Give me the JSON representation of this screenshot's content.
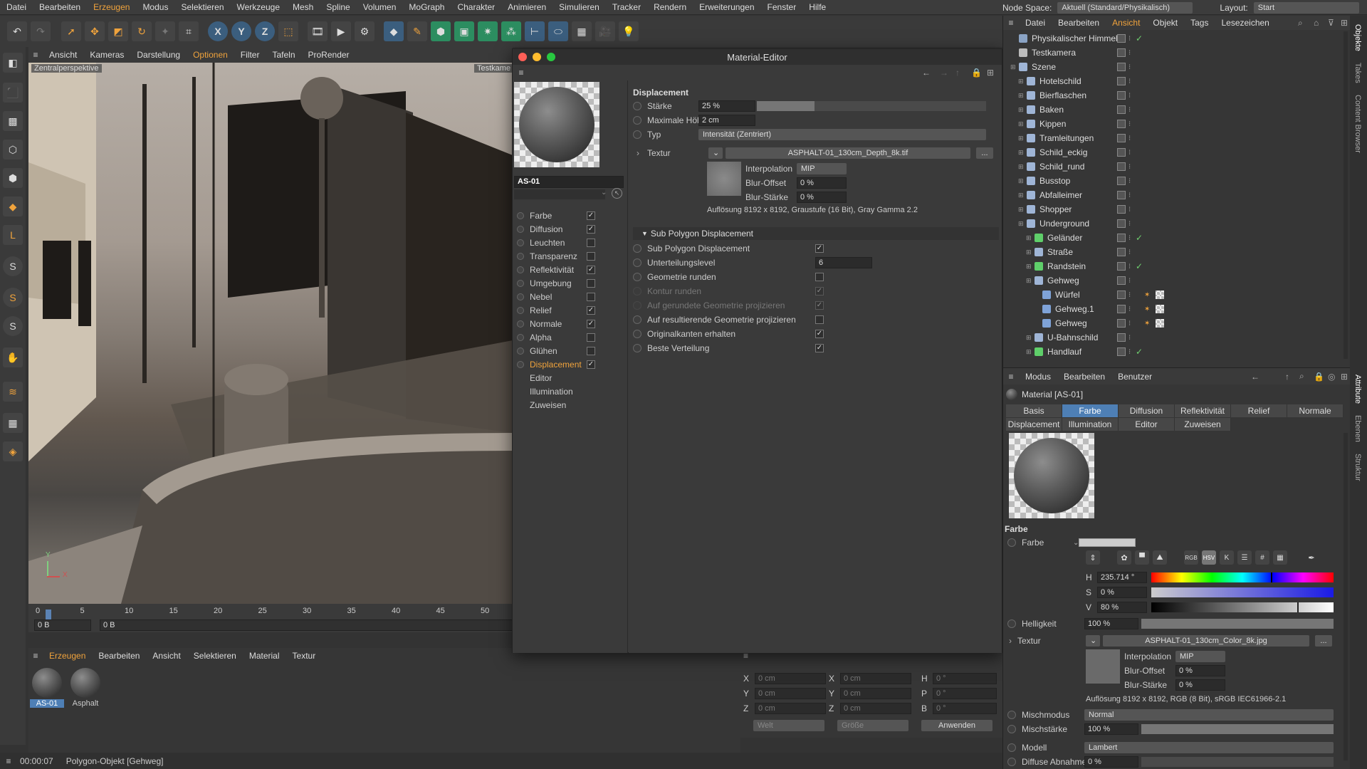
{
  "menubar": {
    "items": [
      "Datei",
      "Bearbeiten",
      "Erzeugen",
      "Modus",
      "Selektieren",
      "Werkzeuge",
      "Mesh",
      "Spline",
      "Volumen",
      "MoGraph",
      "Charakter",
      "Animieren",
      "Simulieren",
      "Tracker",
      "Rendern",
      "Erweiterungen",
      "Fenster",
      "Hilfe"
    ],
    "node_space_label": "Node Space:",
    "node_space_value": "Aktuell (Standard/Physikalisch)",
    "layout_label": "Layout:",
    "layout_value": "Start"
  },
  "toolbar": {
    "axis_x": "X",
    "axis_y": "Y",
    "axis_z": "Z"
  },
  "viewport": {
    "menu": [
      "Ansicht",
      "Kameras",
      "Darstellung",
      "Optionen",
      "Filter",
      "Tafeln",
      "ProRender"
    ],
    "label": "Zentralperspektive",
    "label2": "Testkame",
    "axis_y": "Y",
    "axis_x": "X"
  },
  "timeline": {
    "ticks": [
      "0",
      "5",
      "10",
      "15",
      "20",
      "25",
      "30",
      "35",
      "40",
      "45",
      "50"
    ],
    "start_field": "0 B",
    "cur_field": "0 B"
  },
  "material_manager": {
    "menu": [
      "Erzeugen",
      "Bearbeiten",
      "Ansicht",
      "Selektieren",
      "Material",
      "Textur"
    ],
    "materials": [
      "AS-01",
      "Asphalt"
    ]
  },
  "coords": {
    "x1": "X",
    "x1v": "0 cm",
    "x2": "X",
    "x2v": "0 cm",
    "h": "H",
    "hv": "0 °",
    "y1": "Y",
    "y1v": "0 cm",
    "y2": "Y",
    "y2v": "0 cm",
    "p": "P",
    "pv": "0 °",
    "z1": "Z",
    "z1v": "0 cm",
    "z2": "Z",
    "z2v": "0 cm",
    "b": "B",
    "bv": "0 °",
    "mode1": "Welt",
    "mode2": "Größe",
    "apply": "Anwenden"
  },
  "statusbar": {
    "time": "00:00:07",
    "msg": "Polygon-Objekt [Gehweg]"
  },
  "mateditor": {
    "title": "Material-Editor",
    "name": "AS-01",
    "channels": [
      {
        "label": "Farbe",
        "checked": true
      },
      {
        "label": "Diffusion",
        "checked": true
      },
      {
        "label": "Leuchten",
        "checked": false
      },
      {
        "label": "Transparenz",
        "checked": false
      },
      {
        "label": "Reflektivität",
        "checked": true
      },
      {
        "label": "Umgebung",
        "checked": false
      },
      {
        "label": "Nebel",
        "checked": false
      },
      {
        "label": "Relief",
        "checked": true
      },
      {
        "label": "Normale",
        "checked": true
      },
      {
        "label": "Alpha",
        "checked": false
      },
      {
        "label": "Glühen",
        "checked": false
      },
      {
        "label": "Displacement",
        "checked": true
      }
    ],
    "extra": [
      "Editor",
      "Illumination",
      "Zuweisen"
    ],
    "disp": {
      "header": "Displacement",
      "staerke_label": "Stärke",
      "staerke": "25 %",
      "staerke_pct": 25,
      "maxh_label": "Maximale Höhe",
      "maxh": "2 cm",
      "typ_label": "Typ",
      "typ": "Intensität (Zentriert)",
      "textur_label": "Textur",
      "texfile": "ASPHALT-01_130cm_Depth_8k.tif",
      "dots": "...",
      "interp_label": "Interpolation",
      "interp": "MIP",
      "bluroff_label": "Blur-Offset",
      "bluroff": "0 %",
      "blurst_label": "Blur-Stärke",
      "blurst": "0 %",
      "resolution": "Auflösung 8192 x 8192, Graustufe (16 Bit), Gray Gamma 2.2"
    },
    "spd": {
      "header": "Sub Polygon Displacement",
      "rows": [
        {
          "label": "Sub Polygon Displacement",
          "checked": true,
          "dim": false
        },
        {
          "label": "Unterteilungslevel",
          "value": "6",
          "dim": false
        },
        {
          "label": "Geometrie runden",
          "checked": false,
          "dim": false
        },
        {
          "label": "Kontur runden",
          "checked": true,
          "dim": true
        },
        {
          "label": "Auf gerundete Geometrie projizieren",
          "checked": true,
          "dim": true
        },
        {
          "label": "Auf resultierende Geometrie projizieren",
          "checked": false,
          "dim": false
        },
        {
          "label": "Originalkanten erhalten",
          "checked": true,
          "dim": false
        },
        {
          "label": "Beste Verteilung",
          "checked": true,
          "dim": false
        }
      ]
    }
  },
  "objects": {
    "menu": [
      "Datei",
      "Bearbeiten",
      "Ansicht",
      "Objekt",
      "Tags",
      "Lesezeichen"
    ],
    "items": [
      {
        "name": "Physikalischer Himmel",
        "indent": 0,
        "color": "#8aa3c4",
        "check": true
      },
      {
        "name": "Testkamera",
        "indent": 0,
        "color": "#bbbbbb",
        "check": false
      },
      {
        "name": "Szene",
        "indent": 0,
        "color": "#9fb5d6",
        "check": false
      },
      {
        "name": "Hotelschild",
        "indent": 1,
        "color": "#9fb5d6",
        "check": false
      },
      {
        "name": "Bierflaschen",
        "indent": 1,
        "color": "#9fb5d6",
        "check": false
      },
      {
        "name": "Baken",
        "indent": 1,
        "color": "#9fb5d6",
        "check": false
      },
      {
        "name": "Kippen",
        "indent": 1,
        "color": "#9fb5d6",
        "check": false
      },
      {
        "name": "Tramleitungen",
        "indent": 1,
        "color": "#9fb5d6",
        "check": false
      },
      {
        "name": "Schild_eckig",
        "indent": 1,
        "color": "#9fb5d6",
        "check": false
      },
      {
        "name": "Schild_rund",
        "indent": 1,
        "color": "#9fb5d6",
        "check": false
      },
      {
        "name": "Busstop",
        "indent": 1,
        "color": "#9fb5d6",
        "check": false
      },
      {
        "name": "Abfalleimer",
        "indent": 1,
        "color": "#9fb5d6",
        "check": false
      },
      {
        "name": "Shopper",
        "indent": 1,
        "color": "#9fb5d6",
        "check": false
      },
      {
        "name": "Underground",
        "indent": 1,
        "color": "#9fb5d6",
        "check": false
      },
      {
        "name": "Geländer",
        "indent": 2,
        "color": "#5fcf6a",
        "check": true
      },
      {
        "name": "Straße",
        "indent": 2,
        "color": "#9fb5d6",
        "check": false
      },
      {
        "name": "Randstein",
        "indent": 2,
        "color": "#5fcf6a",
        "check": true
      },
      {
        "name": "Gehweg",
        "indent": 2,
        "color": "#9fb5d6",
        "check": false
      },
      {
        "name": "Würfel",
        "indent": 3,
        "color": "#7fa3d8",
        "check": false
      },
      {
        "name": "Gehweg.1",
        "indent": 3,
        "color": "#7fa3d8",
        "check": false
      },
      {
        "name": "Gehweg",
        "indent": 3,
        "color": "#7fa3d8",
        "check": false
      },
      {
        "name": "U-Bahnschild",
        "indent": 2,
        "color": "#9fb5d6",
        "check": false
      },
      {
        "name": "Handlauf",
        "indent": 2,
        "color": "#5fcf6a",
        "check": true
      }
    ]
  },
  "attributes": {
    "menu": [
      "Modus",
      "Bearbeiten",
      "Benutzer"
    ],
    "title": "Material [AS-01]",
    "tabs1": [
      {
        "label": "Basis",
        "on": false
      },
      {
        "label": "Farbe",
        "on": true
      },
      {
        "label": "Diffusion",
        "on": false
      },
      {
        "label": "Reflektivität",
        "on": false
      },
      {
        "label": "Relief",
        "on": false
      },
      {
        "label": "Normale",
        "on": false
      }
    ],
    "tabs2": [
      "Displacement",
      "Illumination",
      "Editor",
      "Zuweisen"
    ],
    "section": "Farbe",
    "farbe_label": "Farbe",
    "h_label": "H",
    "h_value": "235.714 °",
    "s_label": "S",
    "s_value": "0 %",
    "v_label": "V",
    "v_value": "80 %",
    "h_frac": 0.655,
    "v_frac": 0.8,
    "hell_label": "Helligkeit",
    "hell_value": "100 %",
    "hell_pct": 100,
    "textur_label": "Textur",
    "texfile": "ASPHALT-01_130cm_Color_8k.jpg",
    "dots": "...",
    "interp_label": "Interpolation",
    "interp": "MIP",
    "bluroff_label": "Blur-Offset",
    "bluroff": "0 %",
    "blurst_label": "Blur-Stärke",
    "blurst": "0 %",
    "resolution": "Auflösung 8192 x 8192, RGB (8 Bit), sRGB IEC61966-2.1",
    "misch_label": "Mischmodus",
    "misch": "Normal",
    "mischst_label": "Mischstärke",
    "mischst": "100 %",
    "mischst_pct": 100,
    "modell_label": "Modell",
    "modell": "Lambert",
    "diff_label": "Diffuse Abnahme",
    "diff": "0 %",
    "diff_pct": 0
  },
  "sidetabs": [
    "Objekte",
    "Takes",
    "Content Browser"
  ],
  "sidetabs2": [
    "Attribute",
    "Ebenen",
    "Struktur"
  ],
  "colors": {
    "accent": "#f0a33c",
    "tab_active": "#4e7fb5",
    "bg": "#333333"
  }
}
